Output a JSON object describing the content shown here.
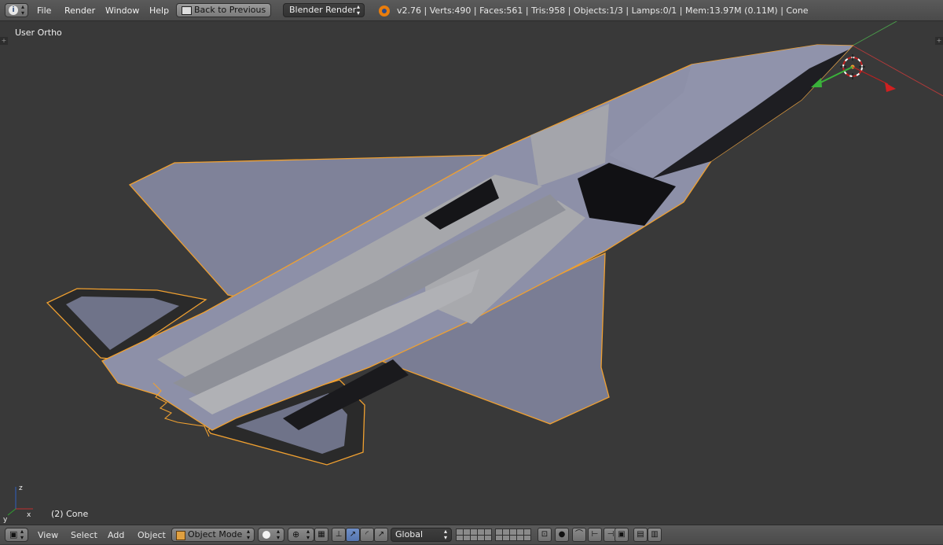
{
  "topbar": {
    "editor_icon": "info-icon",
    "menu": [
      "File",
      "Render",
      "Window",
      "Help"
    ],
    "back_button": "Back to Previous",
    "render_engine": "Blender Render",
    "stats": "v2.76 | Verts:490 | Faces:561 | Tris:958 | Objects:1/3 | Lamps:0/1 | Mem:13.97M (0.11M) | Cone"
  },
  "viewport": {
    "view_name": "User Ortho",
    "object_label": "(2) Cone",
    "colors": {
      "background": "#393939",
      "mesh": "#7f8299",
      "selection_outline": "#f0a030"
    }
  },
  "bottombar": {
    "editor_icon": "3d-view-icon",
    "menu": [
      "View",
      "Select",
      "Add",
      "Object"
    ],
    "mode": "Object Mode",
    "shading_icon": "solid-shading-icon",
    "pivot_icon": "pivot-point-icon",
    "orientation": "Global"
  }
}
